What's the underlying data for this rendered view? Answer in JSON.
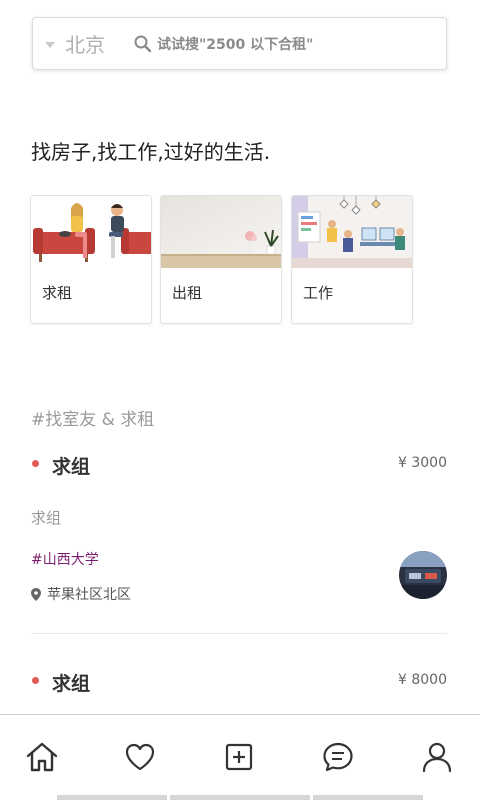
{
  "search": {
    "city": "北京",
    "placeholder": "试试搜\"2500 以下合租\""
  },
  "tagline": "找房子,找工作,过好的生活.",
  "categories": [
    {
      "label": "求租",
      "icon": "couple-on-sofa-illustration"
    },
    {
      "label": "出租",
      "icon": "empty-room-illustration"
    },
    {
      "label": "工作",
      "icon": "office-meeting-illustration"
    }
  ],
  "section_title": "#找室友 & 求租",
  "listings": [
    {
      "title": "求组",
      "price": "¥ 3000",
      "description": "求组",
      "tag": "#山西大学",
      "location": "苹果社区北区"
    },
    {
      "title": "求组",
      "price": "¥ 8000"
    }
  ],
  "tab_bar": [
    "home-icon",
    "heart-icon",
    "add-icon",
    "message-icon",
    "profile-icon"
  ],
  "colors": {
    "accent_dot": "#e05a5a",
    "tag": "#7a1f6e"
  }
}
